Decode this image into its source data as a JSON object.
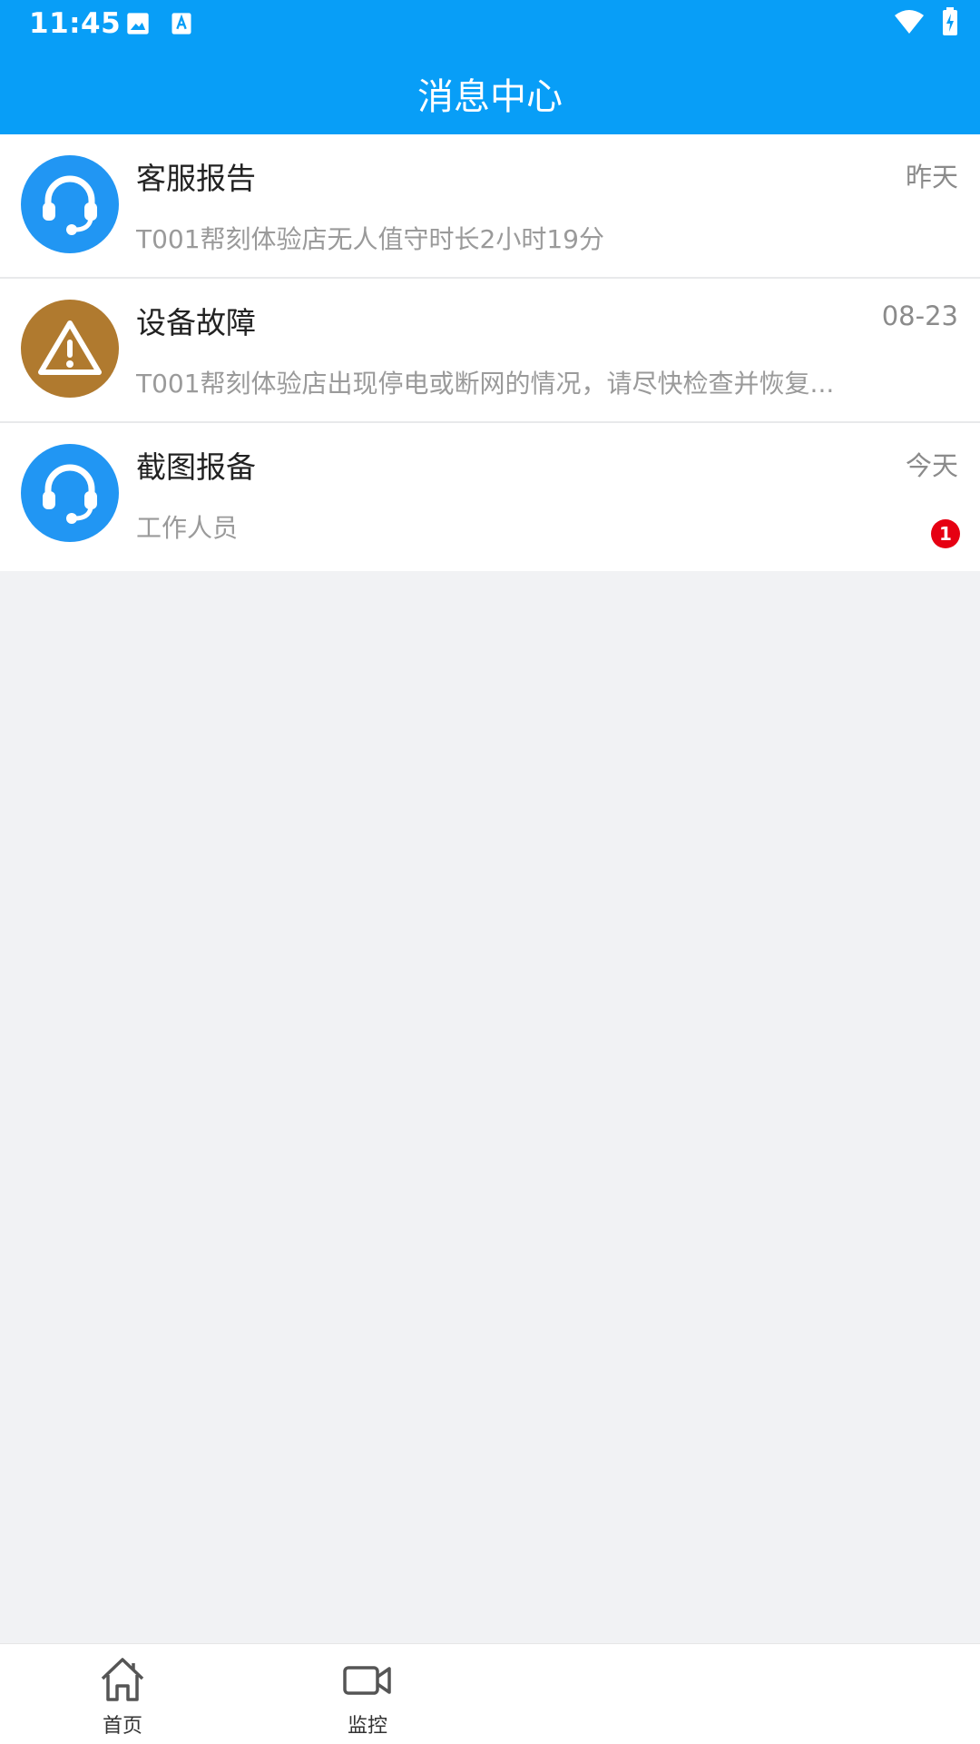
{
  "status_bar": {
    "time": "11:45",
    "icons": [
      "image-icon",
      "text-a-icon",
      "wifi-icon",
      "battery-charging-icon"
    ]
  },
  "header": {
    "title": "消息中心",
    "background": "#089ef7"
  },
  "messages": [
    {
      "title": "客服报告",
      "time": "昨天",
      "desc": "T001帮刻体验店无人值守时长2小时19分",
      "icon": "headset-icon",
      "icon_color": "#2196f3",
      "badge": ""
    },
    {
      "title": "设备故障",
      "time": "08-23",
      "desc": "T001帮刻体验店出现停电或断网的情况，请尽快检查并恢复...",
      "icon": "warning-icon",
      "icon_color": "#b07a2f",
      "badge": ""
    },
    {
      "title": "截图报备",
      "time": "今天",
      "desc": "工作人员",
      "icon": "headset-icon",
      "icon_color": "#2196f3",
      "badge": "1"
    }
  ],
  "bottom_nav": [
    {
      "label": "首页",
      "icon": "home-icon"
    },
    {
      "label": "监控",
      "icon": "video-camera-icon"
    }
  ]
}
